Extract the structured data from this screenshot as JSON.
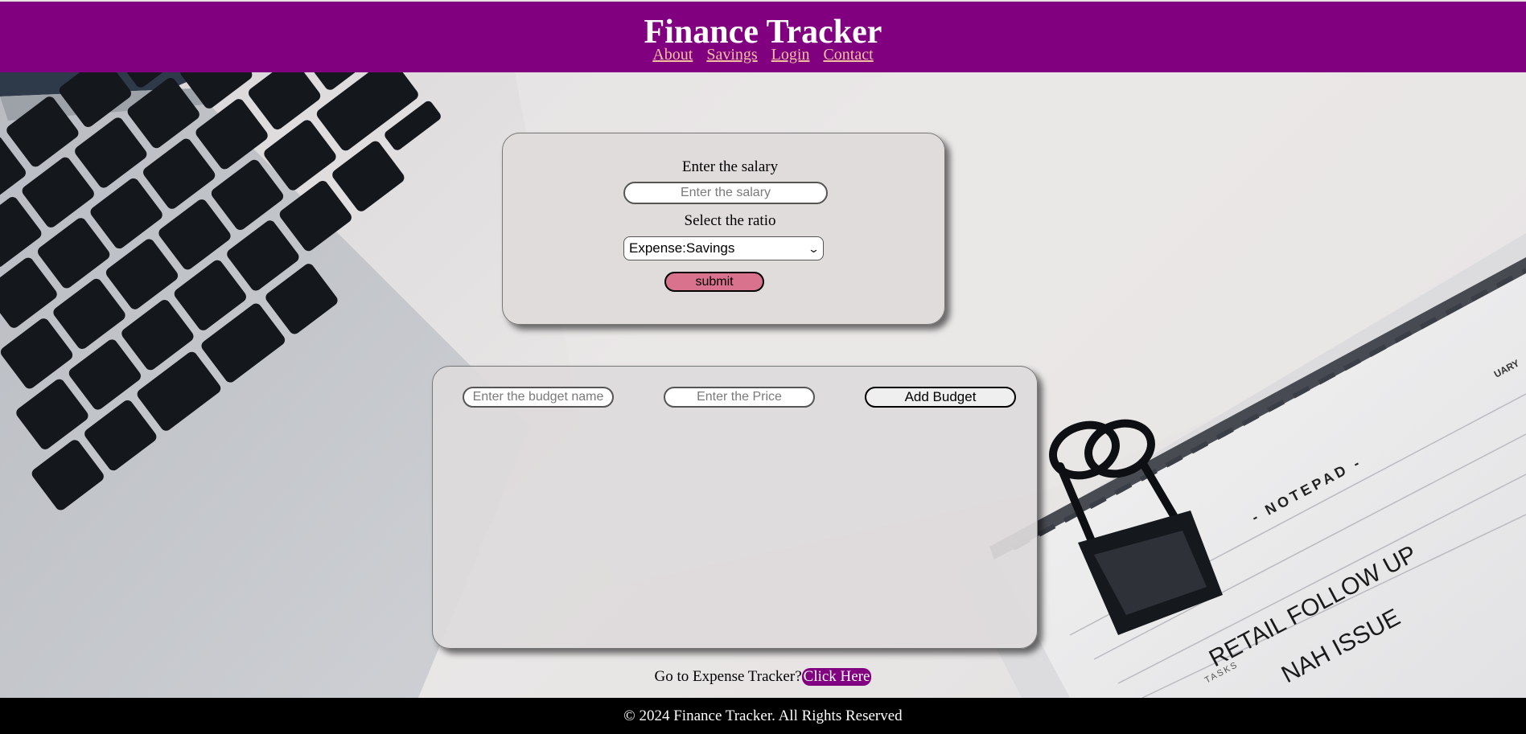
{
  "header": {
    "title": "Finance Tracker",
    "nav": [
      {
        "label": "About"
      },
      {
        "label": "Savings"
      },
      {
        "label": "Login"
      },
      {
        "label": "Contact"
      }
    ]
  },
  "salary_form": {
    "salary_label": "Enter the salary",
    "salary_placeholder": "Enter the salary",
    "salary_value": "",
    "ratio_label": "Select the ratio",
    "ratio_selected": "Expense:Savings",
    "submit_label": "submit"
  },
  "budget_form": {
    "name_placeholder": "Enter the budget name",
    "name_value": "",
    "price_placeholder": "Enter the Price",
    "price_value": "",
    "add_label": "Add Budget"
  },
  "expense_link": {
    "prompt": "Go to Expense Tracker?",
    "link_label": "Click Here"
  },
  "footer": {
    "text": "© 2024 Finance Tracker. All Rights Reserved"
  },
  "colors": {
    "header_bg": "#800080",
    "nav_link": "#f3c0a0",
    "submit_bg": "#d9728d",
    "link_bg": "#800080",
    "footer_bg": "#000000"
  }
}
